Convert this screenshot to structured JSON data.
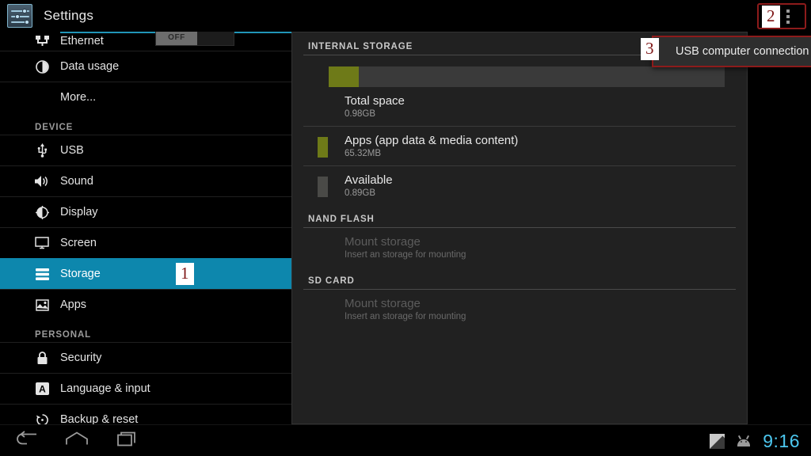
{
  "actionbar": {
    "title": "Settings",
    "app_icon": "settings-sliders-icon",
    "overflow_icon": "overflow-menu-icon",
    "badge": "2"
  },
  "sidebar": {
    "items": [
      {
        "type": "row",
        "label": "Ethernet",
        "icon": "ethernet-icon",
        "toggle": "OFF",
        "clipped": true
      },
      {
        "type": "row",
        "label": "Data usage",
        "icon": "data-usage-icon"
      },
      {
        "type": "row",
        "label": "More...",
        "icon": ""
      },
      {
        "type": "header",
        "label": "DEVICE"
      },
      {
        "type": "row",
        "label": "USB",
        "icon": "usb-icon"
      },
      {
        "type": "row",
        "label": "Sound",
        "icon": "sound-icon"
      },
      {
        "type": "row",
        "label": "Display",
        "icon": "display-brightness-icon"
      },
      {
        "type": "row",
        "label": "Screen",
        "icon": "screen-monitor-icon"
      },
      {
        "type": "row",
        "label": "Storage",
        "icon": "storage-icon",
        "selected": true,
        "badge": "1"
      },
      {
        "type": "row",
        "label": "Apps",
        "icon": "apps-icon"
      },
      {
        "type": "header",
        "label": "PERSONAL"
      },
      {
        "type": "row",
        "label": "Security",
        "icon": "lock-icon"
      },
      {
        "type": "row",
        "label": "Language & input",
        "icon": "language-input-icon"
      },
      {
        "type": "row",
        "label": "Backup & reset",
        "icon": "backup-reset-icon"
      }
    ]
  },
  "content": {
    "sections": [
      {
        "header": "INTERNAL STORAGE"
      },
      {
        "header": "NAND FLASH"
      },
      {
        "header": "SD CARD"
      }
    ],
    "internal_storage": {
      "header": "INTERNAL STORAGE",
      "bar": {
        "used_percent": 7.5,
        "used_color": "#6e7a18",
        "free_color": "#3a3a3a"
      },
      "rows": [
        {
          "title": "Total space",
          "value": "0.98GB",
          "swatch": null
        },
        {
          "title": "Apps (app data & media content)",
          "value": "65.32MB",
          "swatch": "#6e7a18"
        },
        {
          "title": "Available",
          "value": "0.89GB",
          "swatch": "#4a4a47"
        }
      ]
    },
    "nand_flash": {
      "header": "NAND FLASH",
      "row": {
        "title": "Mount storage",
        "value": "Insert an storage for mounting",
        "disabled": true
      }
    },
    "sd_card": {
      "header": "SD CARD",
      "row": {
        "title": "Mount storage",
        "value": "Insert an storage for mounting",
        "disabled": true
      }
    }
  },
  "popup": {
    "label": "USB computer connection",
    "badge": "3"
  },
  "systembar": {
    "back_icon": "back-arrow-icon",
    "home_icon": "home-icon",
    "recents_icon": "recent-apps-icon",
    "signal_icon": "signal-no-service-icon",
    "android_icon": "android-head-icon",
    "clock": "9:16"
  },
  "colors": {
    "accent_selected": "#0d87ad",
    "annotation_red": "#8d1b1b",
    "clock_cyan": "#4cc7ef",
    "storage_used": "#6e7a18"
  }
}
